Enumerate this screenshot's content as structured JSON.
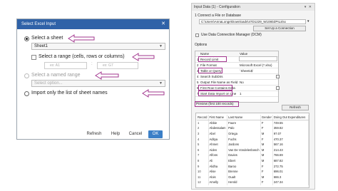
{
  "dialog": {
    "title": "Select Excel Input",
    "close_glyph": "✕",
    "options": {
      "sheet_label": "Select a sheet",
      "sheet_value": "Sheet1",
      "range_label": "Select a range (cells, rows or columns)",
      "range_from_placeholder": "ex: A1",
      "range_to_placeholder": "ex: G7",
      "named_range_label": "Select a named range",
      "named_range_placeholder": "Select option...",
      "import_sheet_names_label": "Import only the list of sheet names"
    },
    "buttons": {
      "refresh": "Refresh",
      "help": "Help",
      "cancel": "Cancel",
      "ok": "OK"
    }
  },
  "window": {
    "title": "Input Data (1) - Configuration",
    "title_controls": "▾ ✕",
    "connect_label": "1  Connect a File or Database",
    "file_path": "C:\\Users\\AnnaLonge\\Downloads\\47D1229_W1080ZPILxlsx",
    "set_connection_button": "Set Up a Connection",
    "use_dcm_label": "Use Data Connection Manager (DCM)",
    "options_label": "Options",
    "table_headers": {
      "name": "Name",
      "value": "Value"
    },
    "option_rows": [
      {
        "n": "1",
        "name": "Record Limit",
        "value": ""
      },
      {
        "n": "2",
        "name": "File Format",
        "value": "Microsoft Excel (*.xlsx)"
      },
      {
        "n": "3",
        "name": "Table or Query",
        "value": "`Sheet1$`"
      },
      {
        "n": "4",
        "name": "Search SubDirs",
        "value": ""
      },
      {
        "n": "5",
        "name": "Output File Name as Field",
        "value": "No"
      },
      {
        "n": "6",
        "name": "First Row Contains Data",
        "value": ""
      },
      {
        "n": "7",
        "name": "Start Data Import on Line",
        "value": "1"
      }
    ],
    "preview_label": "Preview (first 100 records)",
    "refresh_button": "Refresh",
    "preview_columns": [
      "Record",
      "First Name",
      "Last Name",
      "Gender",
      "Doing Out Expenditures"
    ],
    "preview_rows": [
      [
        "1",
        "Abbie",
        "Faure",
        "F",
        "749.55"
      ],
      [
        "2",
        "Abdessalam",
        "Palo",
        "F",
        "359.82"
      ],
      [
        "3",
        "Abel",
        "Ortega",
        "M",
        "97.07"
      ],
      [
        "4",
        "Aditya",
        "Fuchs",
        "F",
        "470.37"
      ],
      [
        "5",
        "Ahmet",
        "Jardons",
        "M",
        "567.16"
      ],
      [
        "6",
        "Aiden",
        "Van De Vondelenbosch",
        "M",
        "214.43"
      ],
      [
        "7",
        "Alfons",
        "Davies",
        "M",
        "766.69"
      ],
      [
        "8",
        "Ali",
        "Ebert",
        "M",
        "687.82"
      ],
      [
        "9",
        "Alidha",
        "Baroo",
        "F",
        "272.75"
      ],
      [
        "10",
        "Alise",
        "Brenne",
        "F",
        "696.01"
      ],
      [
        "11",
        "Alois",
        "Oualt",
        "M",
        "666.3"
      ],
      [
        "12",
        "Amelly",
        "Herold",
        "F",
        "247.34"
      ]
    ]
  }
}
